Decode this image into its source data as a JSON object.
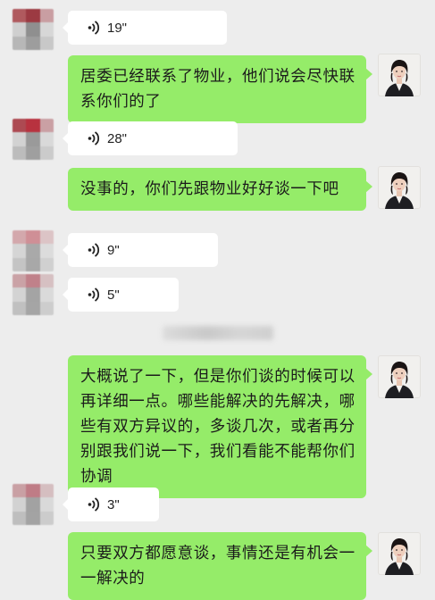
{
  "messages": [
    {
      "kind": "voice",
      "duration": "19\""
    },
    {
      "kind": "text",
      "text": "居委已经联系了物业，他们说会尽快联系你们的了"
    },
    {
      "kind": "voice",
      "duration": "28\""
    },
    {
      "kind": "text",
      "text": "没事的，你们先跟物业好好谈一下吧"
    },
    {
      "kind": "voice",
      "duration": "9\""
    },
    {
      "kind": "voice",
      "duration": "5\""
    },
    {
      "kind": "text",
      "text": "大概说了一下，但是你们谈的时候可以再详细一点。哪些能解决的先解决，哪些有双方异议的，多谈几次，或者再分别跟我们说一下，我们看能不能帮你们协调"
    },
    {
      "kind": "voice",
      "duration": "3\""
    },
    {
      "kind": "text",
      "text": "只要双方都愿意谈，事情还是有机会一一解决的"
    }
  ],
  "icons": {
    "voice": "voice-wave-icon",
    "avatar": "avatar-icon"
  },
  "colors": {
    "background": "#ededed",
    "outgoing_bubble": "#95ec69",
    "incoming_bubble": "#ffffff"
  }
}
